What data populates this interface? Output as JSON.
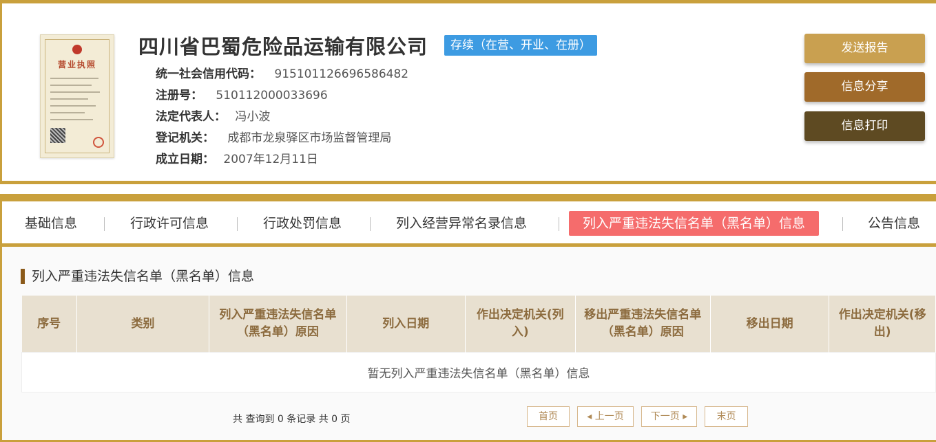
{
  "company": {
    "name": "四川省巴蜀危险品运输有限公司",
    "status": "存续（在营、开业、在册）",
    "license_title": "营业执照",
    "fields": [
      {
        "label": "统一社会信用代码：",
        "value": "915101126696586482"
      },
      {
        "label": "注册号：",
        "value": "510112000033696"
      },
      {
        "label": "法定代表人：",
        "value": "冯小波"
      },
      {
        "label": "登记机关：",
        "value": "成都市龙泉驿区市场监督管理局"
      },
      {
        "label": "成立日期：",
        "value": "2007年12月11日"
      }
    ]
  },
  "actions": {
    "send_report": "发送报告",
    "share_info": "信息分享",
    "print_info": "信息打印"
  },
  "tabs": [
    {
      "label": "基础信息"
    },
    {
      "label": "行政许可信息"
    },
    {
      "label": "行政处罚信息"
    },
    {
      "label": "列入经营异常名录信息"
    },
    {
      "label": "列入严重违法失信名单（黑名单）信息",
      "active": true
    },
    {
      "label": "公告信息"
    }
  ],
  "section": {
    "title": "列入严重违法失信名单（黑名单）信息",
    "columns": [
      "序号",
      "类别",
      "列入严重违法失信名单（黑名单）原因",
      "列入日期",
      "作出决定机关(列入)",
      "移出严重违法失信名单（黑名单）原因",
      "移出日期",
      "作出决定机关(移出)"
    ],
    "empty_text": "暂无列入严重违法失信名单（黑名单）信息"
  },
  "pagination": {
    "summary": "共 查询到 0 条记录 共 0 页",
    "first": "首页",
    "prev": "◂ 上一页",
    "next": "下一页 ▸",
    "last": "末页"
  },
  "colors": {
    "gold_border": "#c9a03c",
    "send_btn": "#c9a050",
    "share_btn": "#a06a2a",
    "print_btn": "#5e4a22",
    "status_badge": "#3d9be2",
    "active_tab": "#f56c6c"
  }
}
